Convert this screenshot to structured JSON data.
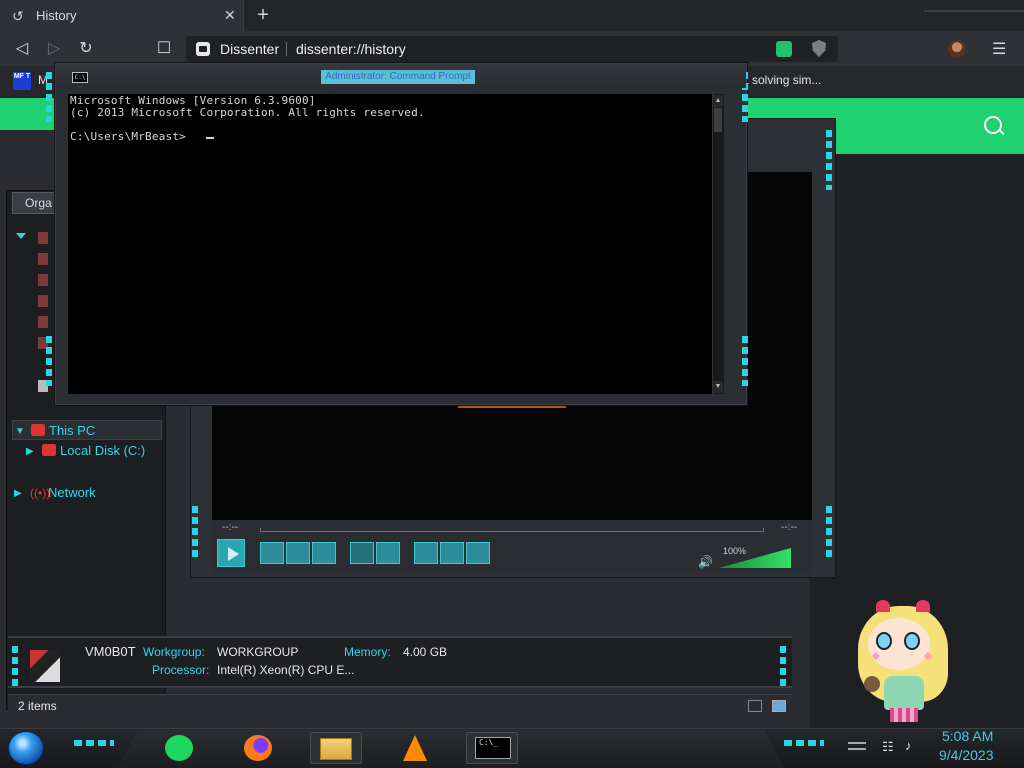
{
  "browser": {
    "tab": {
      "title": "History",
      "icon": "history-icon",
      "close_icon": "close-icon"
    },
    "new_tab_icon": "plus-icon",
    "toolbar": {
      "back_icon": "back-icon",
      "forward_icon": "forward-icon",
      "reload_icon": "reload-icon",
      "bookmark_icon": "bookmark-icon",
      "site_name": "Dissenter",
      "url": "dissenter://history",
      "menu_icon": "menu-icon"
    },
    "bookmarks": {
      "first_icon_text": "MF T",
      "first_label": "M",
      "right_label": "a solving sim..."
    }
  },
  "cmd": {
    "title": "Administrator: Command Prompt",
    "icon_text": "C:\\",
    "lines": [
      "Microsoft Windows [Version 6.3.9600]",
      "(c) 2013 Microsoft Corporation. All rights reserved.",
      "C:\\Users\\MrBeast>"
    ]
  },
  "explorer": {
    "organize_label": "Orga",
    "nav": {
      "this_pc": "This PC",
      "local_disk": "Local Disk (C:)",
      "network": "Network"
    },
    "details": {
      "computer_name": "VM0B0T",
      "workgroup_label": "Workgroup:",
      "workgroup_value": "WORKGROUP",
      "memory_label": "Memory:",
      "memory_value": "4.00 GB",
      "processor_label": "Processor:",
      "processor_value": "Intel(R) Xeon(R) CPU E..."
    },
    "status_items": "2 items"
  },
  "player": {
    "time_left": "--:--",
    "time_right": "--:--",
    "volume_label": "100%",
    "volume_fraction": 1.0
  },
  "taskbar": {
    "apps": [
      "spotify",
      "firefox",
      "file-explorer",
      "vlc",
      "command-prompt"
    ],
    "cmd_icon_text": "C:\\_",
    "clock_time": "5:08 AM",
    "clock_date": "9/4/2023"
  },
  "colors": {
    "accent_cyan": "#2ad5e3",
    "dissenter_green": "#1fd16f",
    "clock_blue": "#48c8e6"
  }
}
